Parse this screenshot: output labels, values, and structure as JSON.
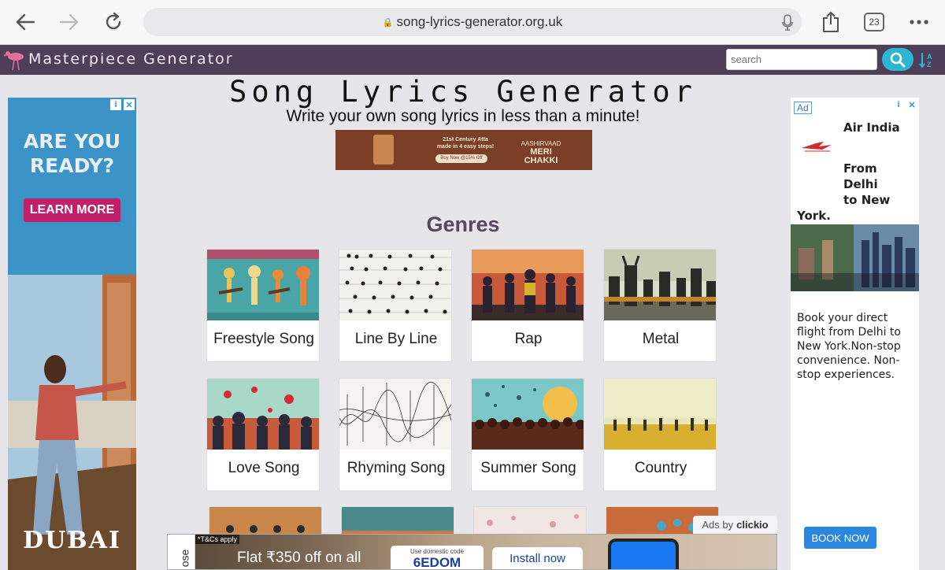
{
  "browser": {
    "url": "song-lyrics-generator.org.uk",
    "tab_count": "23"
  },
  "site": {
    "name": "Masterpiece Generator",
    "search_placeholder": "search"
  },
  "page": {
    "title": "Song Lyrics Generator",
    "subtitle": "Write your own song lyrics in less than a minute!",
    "genres_heading": "Genres"
  },
  "genres": [
    {
      "label": "Freestyle Song"
    },
    {
      "label": "Line By Line"
    },
    {
      "label": "Rap"
    },
    {
      "label": "Metal"
    },
    {
      "label": "Love Song"
    },
    {
      "label": "Rhyming Song"
    },
    {
      "label": "Summer Song"
    },
    {
      "label": "Country"
    }
  ],
  "banner_ad": {
    "line1": "21st Century Atta",
    "line2": "made in 4 easy steps!",
    "button": "Buy Now @15% Off",
    "brand_top": "AASHIRVAAD",
    "brand_bottom": "MERI CHAKKI"
  },
  "left_ad": {
    "headline_1": "ARE YOU",
    "headline_2": "READY?",
    "cta": "LEARN MORE",
    "brand": "DUBAI"
  },
  "right_ad": {
    "badge": "Ad",
    "title": "Air India",
    "sub_1": "From Delhi",
    "sub_2": "to New",
    "sub_3": "York.",
    "body": "Book your direct flight from Delhi to New York.Non-stop convenience. Non-stop experiences.",
    "button": "BOOK NOW"
  },
  "bottom_ad": {
    "ads_by": "Ads by",
    "ads_brand": "clickio",
    "close_label": "ose",
    "tcs": "*T&Cs apply",
    "offer": "Flat ₹350 off on all",
    "promo_line": "Use domestic code",
    "promo_code": "6EDOM",
    "install": "Install now"
  },
  "colors": {
    "header_bg": "#4f3e58",
    "search_btn": "#2bb7d3",
    "genres_heading": "#57485f",
    "book_btn": "#2b86e0"
  }
}
